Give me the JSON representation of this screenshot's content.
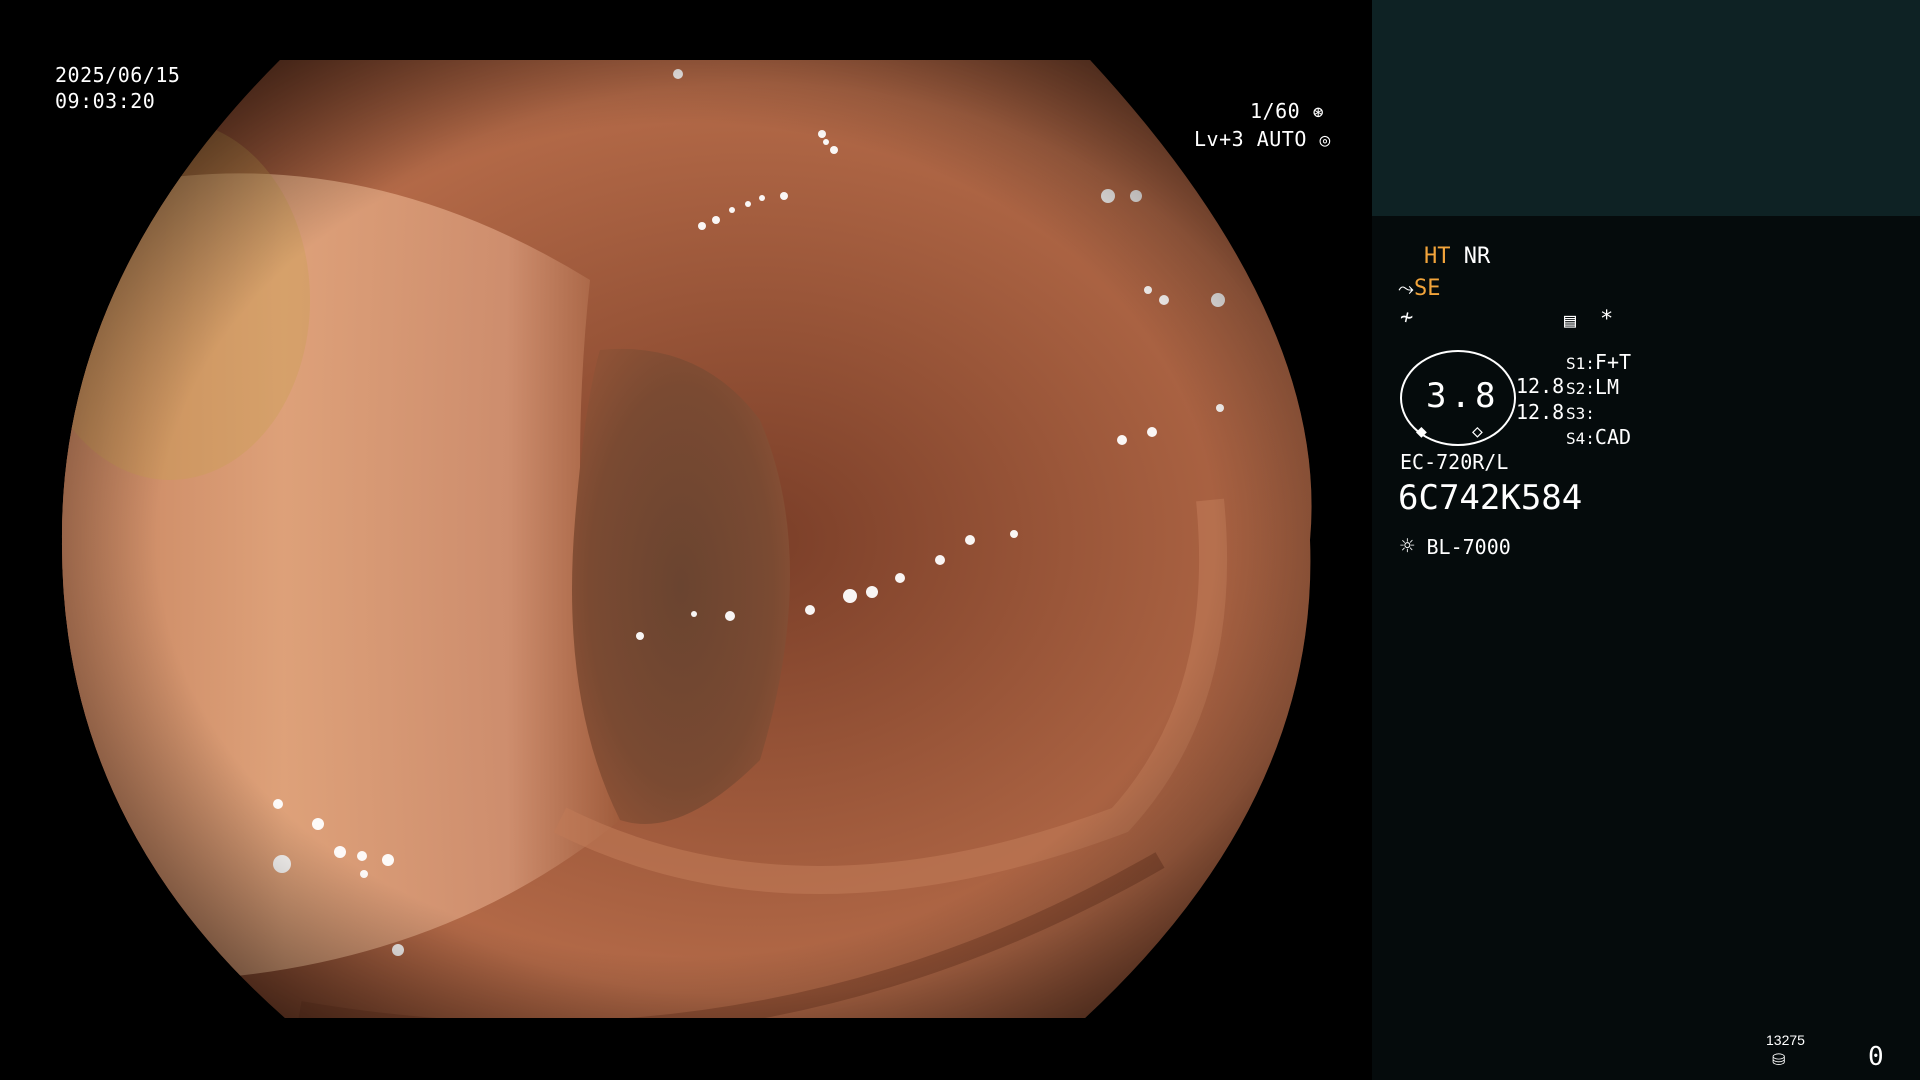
{
  "overlay": {
    "date": "2025/06/15",
    "time": "09:03:20",
    "shutter": "1/60",
    "level": "Lv+3",
    "mode": "AUTO"
  },
  "panel": {
    "ht": "HT",
    "nr": "NR",
    "se": "SE",
    "asterisk": "*",
    "gauge_value": "3.8",
    "val1": "12.8",
    "val2": "12.8",
    "s1_label": "S1:",
    "s1_value": "F+T",
    "s2_label": "S2:",
    "s2_value": "LM",
    "s3_label": "S3:",
    "s3_value": "",
    "s4_label": "S4:",
    "s4_value": "CAD",
    "scope_model": "EC-720R/L",
    "serial": "6C742K584",
    "light_source": "BL-7000",
    "counter_small": "13275",
    "counter": "0"
  },
  "colors": {
    "panel_bg": "#050b0c",
    "panel_top_bg": "#0e2224",
    "accent_orange": "#f2a43b",
    "tissue": "#b06a48"
  }
}
